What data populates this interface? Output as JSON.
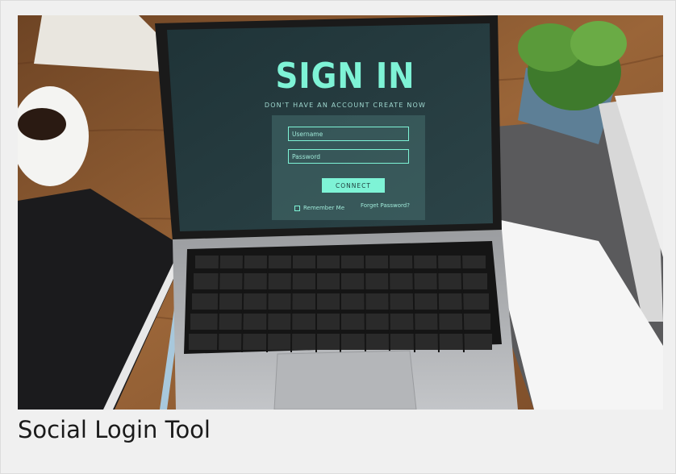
{
  "card": {
    "caption": "Social Login Tool"
  },
  "photo": {
    "description_icon": "laptop-photo",
    "screen": {
      "title": "SIGN IN",
      "subtitle": "DON'T HAVE AN ACCOUNT CREATE NOW",
      "username_placeholder": "Username",
      "password_placeholder": "Password",
      "connect_label": "CONNECT",
      "remember_label": "Remember Me",
      "forgot_label": "Forget Password?"
    },
    "colors": {
      "accent": "#7ef3d6",
      "screen_bg": "#243a3e",
      "desk": "#8a5a32"
    }
  }
}
